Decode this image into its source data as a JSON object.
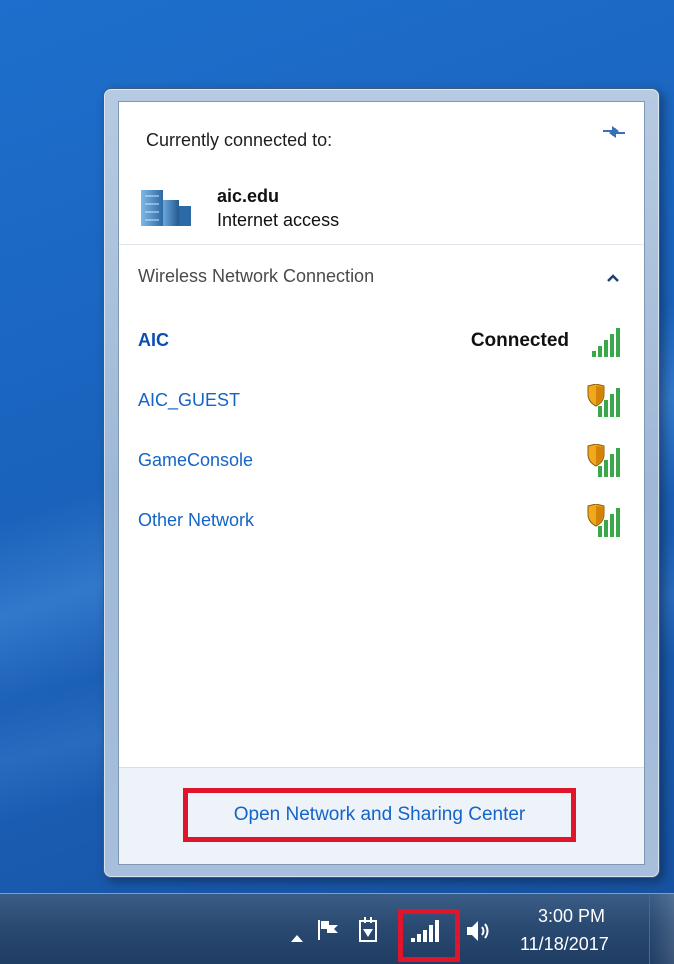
{
  "popup": {
    "current_label": "Currently connected to:",
    "current_network": {
      "name": "aic.edu",
      "access": "Internet access"
    },
    "section_title": "Wireless Network Connection",
    "networks": [
      {
        "name": "AIC",
        "status": "Connected",
        "secured": false,
        "connected": true
      },
      {
        "name": "AIC_GUEST",
        "status": "",
        "secured": true,
        "connected": false
      },
      {
        "name": "GameConsole",
        "status": "",
        "secured": true,
        "connected": false
      },
      {
        "name": "Other Network",
        "status": "",
        "secured": true,
        "connected": false
      }
    ],
    "footer_link": "Open Network and Sharing Center",
    "icons": {
      "refresh": "refresh-arrows-icon",
      "network": "network-building-icon",
      "collapse": "chevron-up-icon",
      "signal": "wifi-signal-icon",
      "shield": "security-shield-icon"
    },
    "colors": {
      "link": "#1464c8",
      "highlight_box": "#e0142b",
      "signal_green": "#3aa84a",
      "shield": "#f1a91b"
    }
  },
  "taskbar": {
    "clock_time": "3:00 PM",
    "clock_date": "11/18/2017",
    "tray_icons": [
      "show-hidden-icons-icon",
      "action-center-flag-icon",
      "power-plug-icon",
      "wifi-signal-icon",
      "speaker-icon"
    ]
  }
}
